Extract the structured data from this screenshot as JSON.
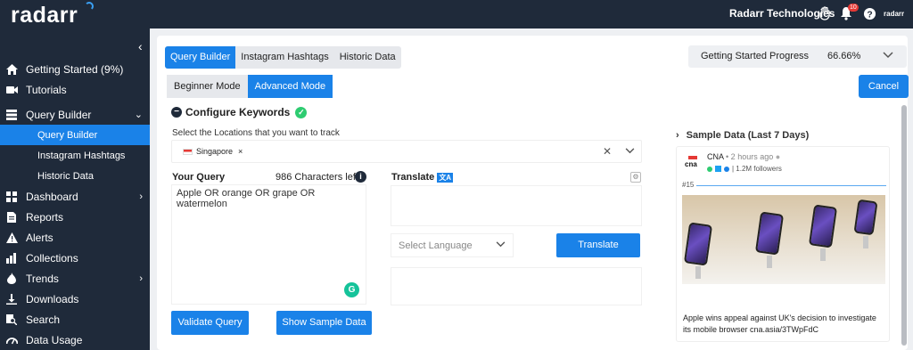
{
  "app": {
    "logo": "radarr"
  },
  "topbar": {
    "org_name": "Radarr Technologies",
    "notification_count": "10",
    "small_logo": "radarr",
    "icons": [
      "hand-wave-icon",
      "bell-icon",
      "help-icon"
    ]
  },
  "sidebar": {
    "collapse_glyph": "‹",
    "items": [
      {
        "label": "Getting Started (9%)",
        "icon": "home-icon"
      },
      {
        "label": "Tutorials",
        "icon": "video-icon"
      },
      {
        "label": "Query Builder",
        "icon": "stack-icon",
        "expanded": true
      },
      {
        "label": "Dashboard",
        "icon": "grid-icon",
        "has_children": true
      },
      {
        "label": "Reports",
        "icon": "document-icon"
      },
      {
        "label": "Alerts",
        "icon": "warning-icon"
      },
      {
        "label": "Collections",
        "icon": "collection-icon"
      },
      {
        "label": "Trends",
        "icon": "flame-icon",
        "has_children": true
      },
      {
        "label": "Downloads",
        "icon": "download-icon"
      },
      {
        "label": "Search",
        "icon": "search-doc-icon"
      },
      {
        "label": "Data Usage",
        "icon": "gauge-icon"
      }
    ],
    "sub_items": [
      {
        "label": "Query Builder",
        "active": true
      },
      {
        "label": "Instagram Hashtags"
      },
      {
        "label": "Historic Data"
      }
    ]
  },
  "main": {
    "tabs": [
      {
        "label": "Query Builder",
        "active": true
      },
      {
        "label": "Instagram Hashtags"
      },
      {
        "label": "Historic Data"
      }
    ],
    "modes": [
      {
        "label": "Beginner Mode"
      },
      {
        "label": "Advanced Mode",
        "active": true
      }
    ],
    "progress": {
      "label": "Getting Started Progress",
      "value": "66.66%"
    },
    "cancel_label": "Cancel",
    "config_title": "Configure Keywords",
    "locations": {
      "label": "Select the Locations that you want to track",
      "selected": "Singapore"
    },
    "query": {
      "label": "Your Query",
      "chars_left": "986 Characters left",
      "value": "Apple OR orange OR grape OR watermelon"
    },
    "translate": {
      "label": "Translate",
      "badge": "文A",
      "language_placeholder": "Select Language",
      "button_label": "Translate"
    },
    "validate_label": "Validate Query",
    "sample_label": "Show Sample Data",
    "sample_data": {
      "title": "Sample Data (Last 7 Days)",
      "post": {
        "source": "CNA",
        "time": "• 2 hours ago",
        "followers": "| 1.2M followers",
        "logo_text": "cna",
        "number": "#15",
        "text": "Apple wins appeal against UK's decision to investigate its mobile browser cna.asia/3TWpFdC"
      }
    }
  },
  "colors": {
    "accent": "#1a82e8",
    "sidebar_bg": "#1f2a3a",
    "success": "#2ecc71"
  }
}
